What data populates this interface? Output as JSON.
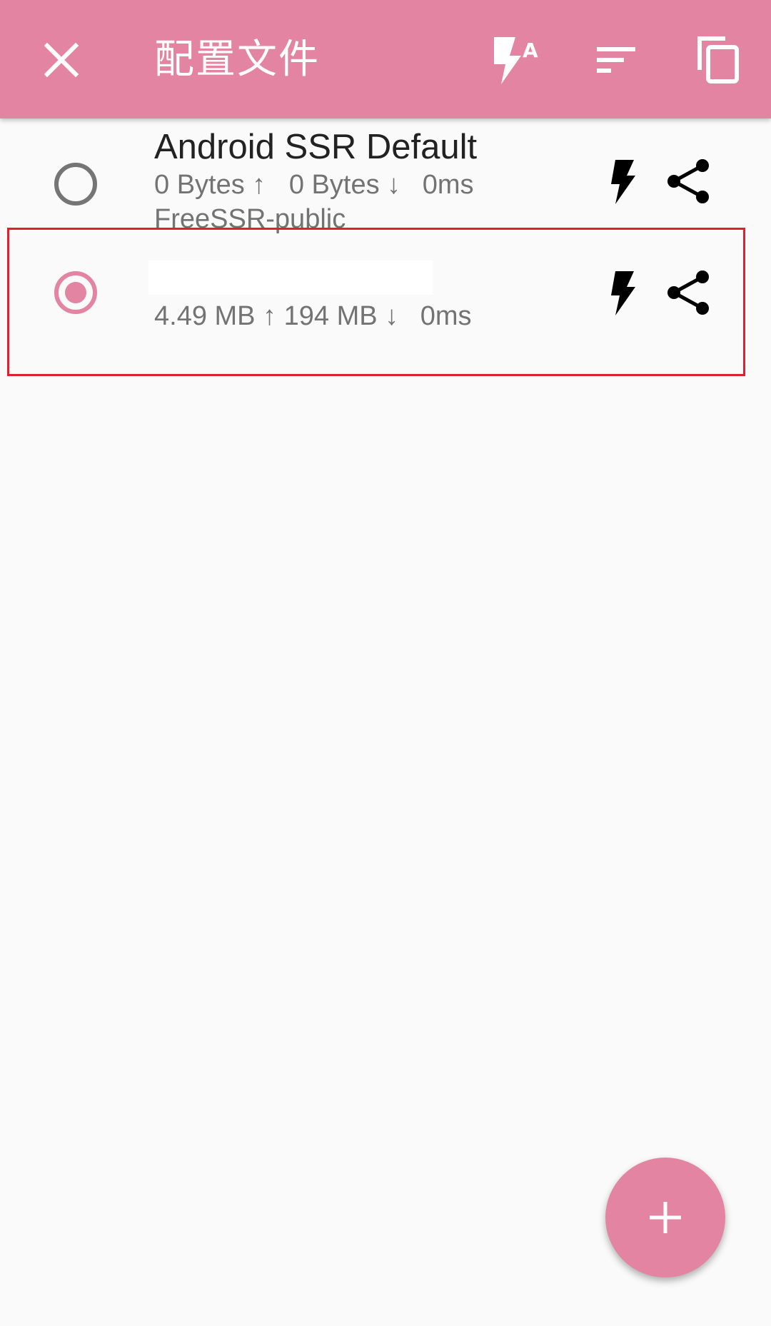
{
  "toolbar": {
    "title": "配置文件",
    "close_icon": "close-icon",
    "test_icon": "flash-auto-icon",
    "sort_icon": "sort-icon",
    "copy_icon": "copy-icon"
  },
  "profiles": [
    {
      "name": "Android SSR Default",
      "selected": false,
      "tx": "0 Bytes",
      "rx": "0 Bytes",
      "latency": "0ms",
      "group": "FreeSSR-public"
    },
    {
      "name": "",
      "selected": true,
      "tx": "4.49 MB",
      "rx": "194 MB",
      "latency": "0ms",
      "group": ""
    }
  ],
  "arrows": {
    "up": "↑",
    "down": "↓"
  },
  "colors": {
    "primary": "#e384a2",
    "background": "#fafafa",
    "highlight": "#e02030"
  }
}
